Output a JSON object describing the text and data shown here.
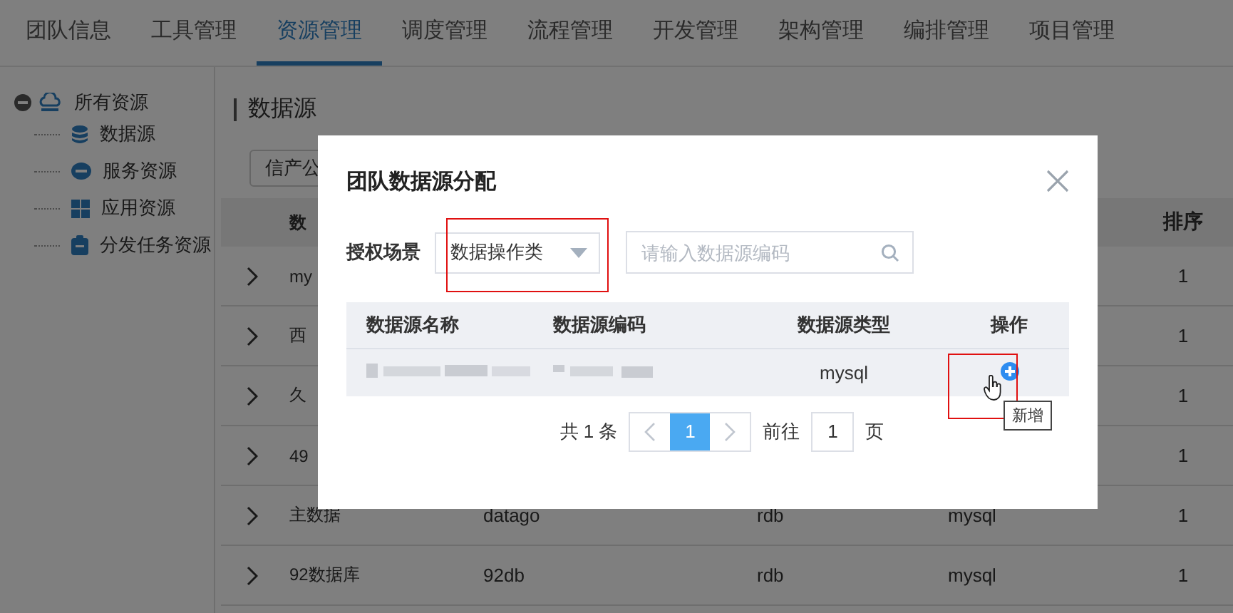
{
  "tabs": [
    {
      "label": "团队信息",
      "selected": false
    },
    {
      "label": "工具管理",
      "selected": false
    },
    {
      "label": "资源管理",
      "selected": true
    },
    {
      "label": "调度管理",
      "selected": false
    },
    {
      "label": "流程管理",
      "selected": false
    },
    {
      "label": "开发管理",
      "selected": false
    },
    {
      "label": "架构管理",
      "selected": false
    },
    {
      "label": "编排管理",
      "selected": false
    },
    {
      "label": "项目管理",
      "selected": false
    }
  ],
  "sidebar": {
    "tree": [
      {
        "label": "所有资源",
        "expanded": true,
        "children": [
          {
            "label": "数据源"
          },
          {
            "label": "服务资源"
          },
          {
            "label": "应用资源"
          },
          {
            "label": "分发任务资源"
          }
        ]
      }
    ]
  },
  "page_title": "数据源",
  "filter": {
    "value": "信产公"
  },
  "table": {
    "columns": [
      "数",
      "排序"
    ],
    "rows": [
      {
        "name": "my",
        "order": "1"
      },
      {
        "name": "西",
        "order": "1"
      },
      {
        "name": "久",
        "order": "1"
      },
      {
        "name": "49",
        "order": "1"
      },
      {
        "name": "主数据",
        "code": "datago",
        "type": "rdb",
        "db_type": "mysql",
        "order": "1"
      },
      {
        "name": "92数据库",
        "code": "92db",
        "type": "rdb",
        "db_type": "mysql",
        "order": "1"
      }
    ]
  },
  "dialog": {
    "title": "团队数据源分配",
    "scene_label": "授权场景",
    "scene_value": "数据操作类",
    "search": {
      "placeholder": "请输入数据源编码"
    },
    "columns": [
      "数据源名称",
      "数据源编码",
      "数据源类型",
      "操作"
    ],
    "rows": [
      {
        "type": "mysql"
      }
    ],
    "total": "共 1 条",
    "pages": [
      {
        "label": "1",
        "selected": true
      }
    ],
    "goto_label": "前往",
    "goto_value": "1",
    "page_unit": "页",
    "tooltip": "新增"
  }
}
